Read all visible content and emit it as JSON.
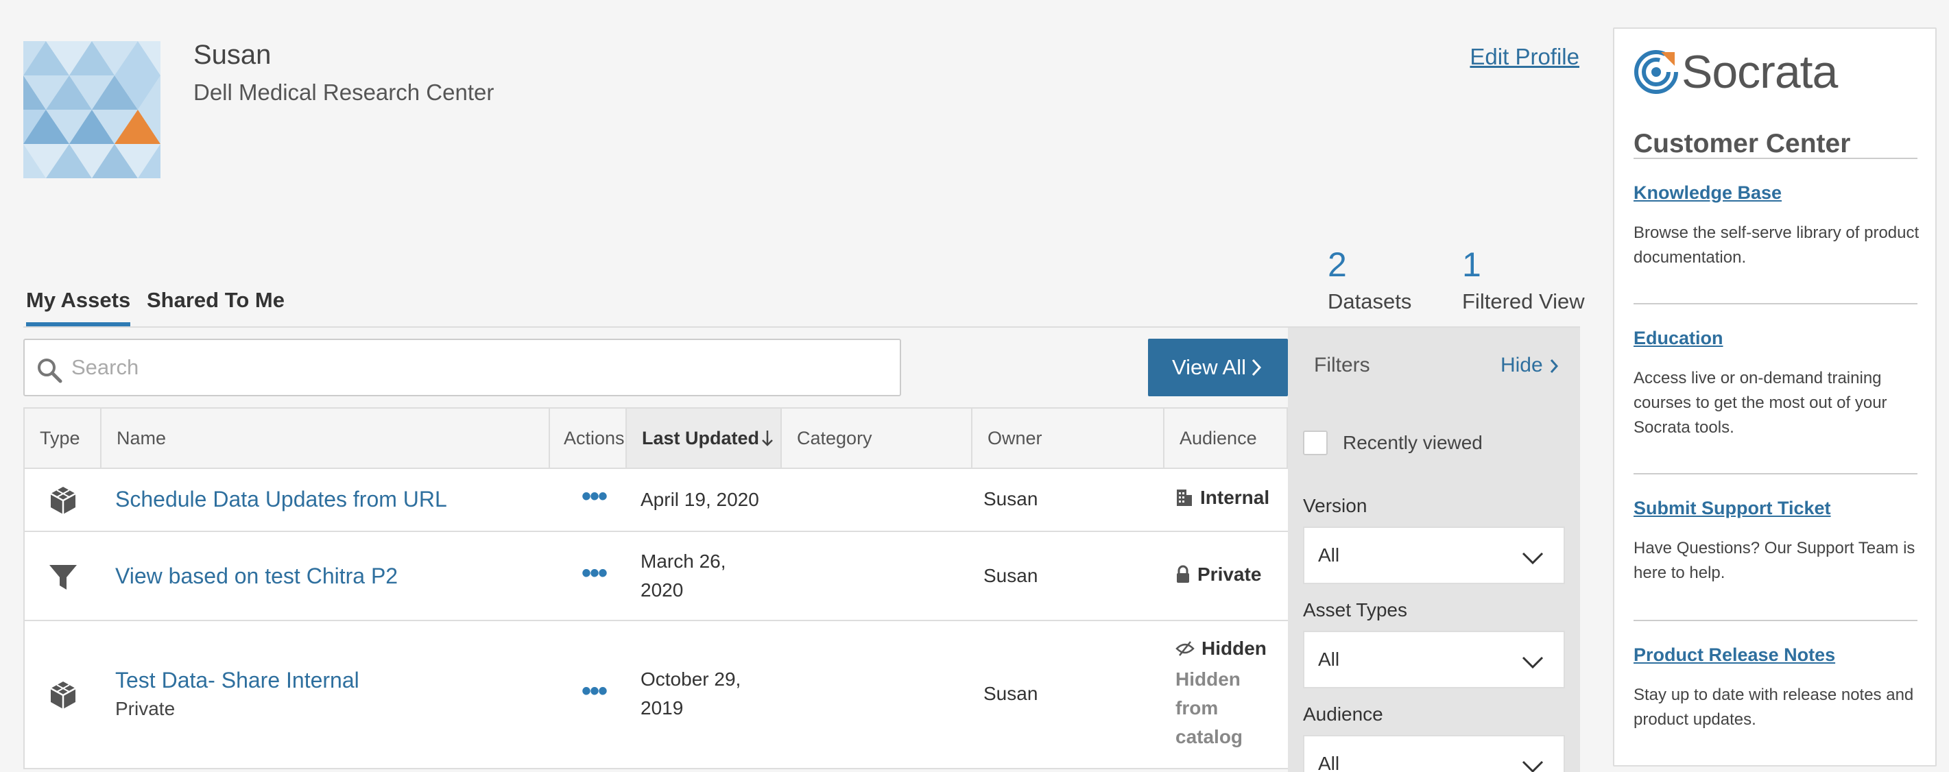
{
  "profile": {
    "name": "Susan",
    "organization": "Dell Medical Research Center",
    "edit_label": "Edit Profile"
  },
  "tabs": [
    {
      "label": "My Assets",
      "active": true
    },
    {
      "label": "Shared To Me",
      "active": false
    }
  ],
  "counts": [
    {
      "value": "2",
      "label": "Datasets"
    },
    {
      "value": "1",
      "label": "Filtered View"
    }
  ],
  "search": {
    "placeholder": "Search",
    "value": ""
  },
  "view_all_label": "View All",
  "table": {
    "columns": [
      "Type",
      "Name",
      "Actions",
      "Last Updated",
      "Category",
      "Owner",
      "Audience"
    ],
    "sorted_column": "Last Updated",
    "rows": [
      {
        "type_icon": "dataset-icon",
        "name": "Schedule Data Updates from URL",
        "sub": "",
        "actions": "•••",
        "last_updated": "April 19, 2020",
        "category": "",
        "owner": "Susan",
        "audience_icon": "building-icon",
        "audience": "Internal",
        "audience_sub": ""
      },
      {
        "type_icon": "filter-icon",
        "name": "View based on test Chitra P2",
        "sub": "",
        "actions": "•••",
        "last_updated": "March 26, 2020",
        "category": "",
        "owner": "Susan",
        "audience_icon": "lock-icon",
        "audience": "Private",
        "audience_sub": ""
      },
      {
        "type_icon": "dataset-icon",
        "name": "Test Data- Share Internal",
        "sub": "Private",
        "actions": "•••",
        "last_updated": "October 29, 2019",
        "category": "",
        "owner": "Susan",
        "audience_icon": "hidden-eye-icon",
        "audience": "Hidden",
        "audience_sub": "Hidden from catalog"
      }
    ]
  },
  "filters": {
    "title": "Filters",
    "hide_label": "Hide",
    "recently_viewed_label": "Recently viewed",
    "recently_viewed_checked": false,
    "version_label": "Version",
    "version_value": "All",
    "asset_types_label": "Asset Types",
    "asset_types_value": "All",
    "audience_label": "Audience",
    "audience_value": "All"
  },
  "sidebar": {
    "logo_text": "Socrata",
    "title": "Customer Center",
    "links": [
      {
        "label": "Knowledge Base",
        "desc": "Browse the self-serve library of product documentation."
      },
      {
        "label": "Education",
        "desc": "Access live or on-demand training courses to get the most out of your Socrata tools."
      },
      {
        "label": "Submit Support Ticket",
        "desc": "Have Questions? Our Support Team is here to help."
      },
      {
        "label": "Product Release Notes",
        "desc": "Stay up to date with release notes and product updates."
      }
    ]
  },
  "colors": {
    "accent": "#2e6f9e",
    "avatar_highlight": "#e8883a",
    "logo_mark": "#2e7bb4"
  }
}
